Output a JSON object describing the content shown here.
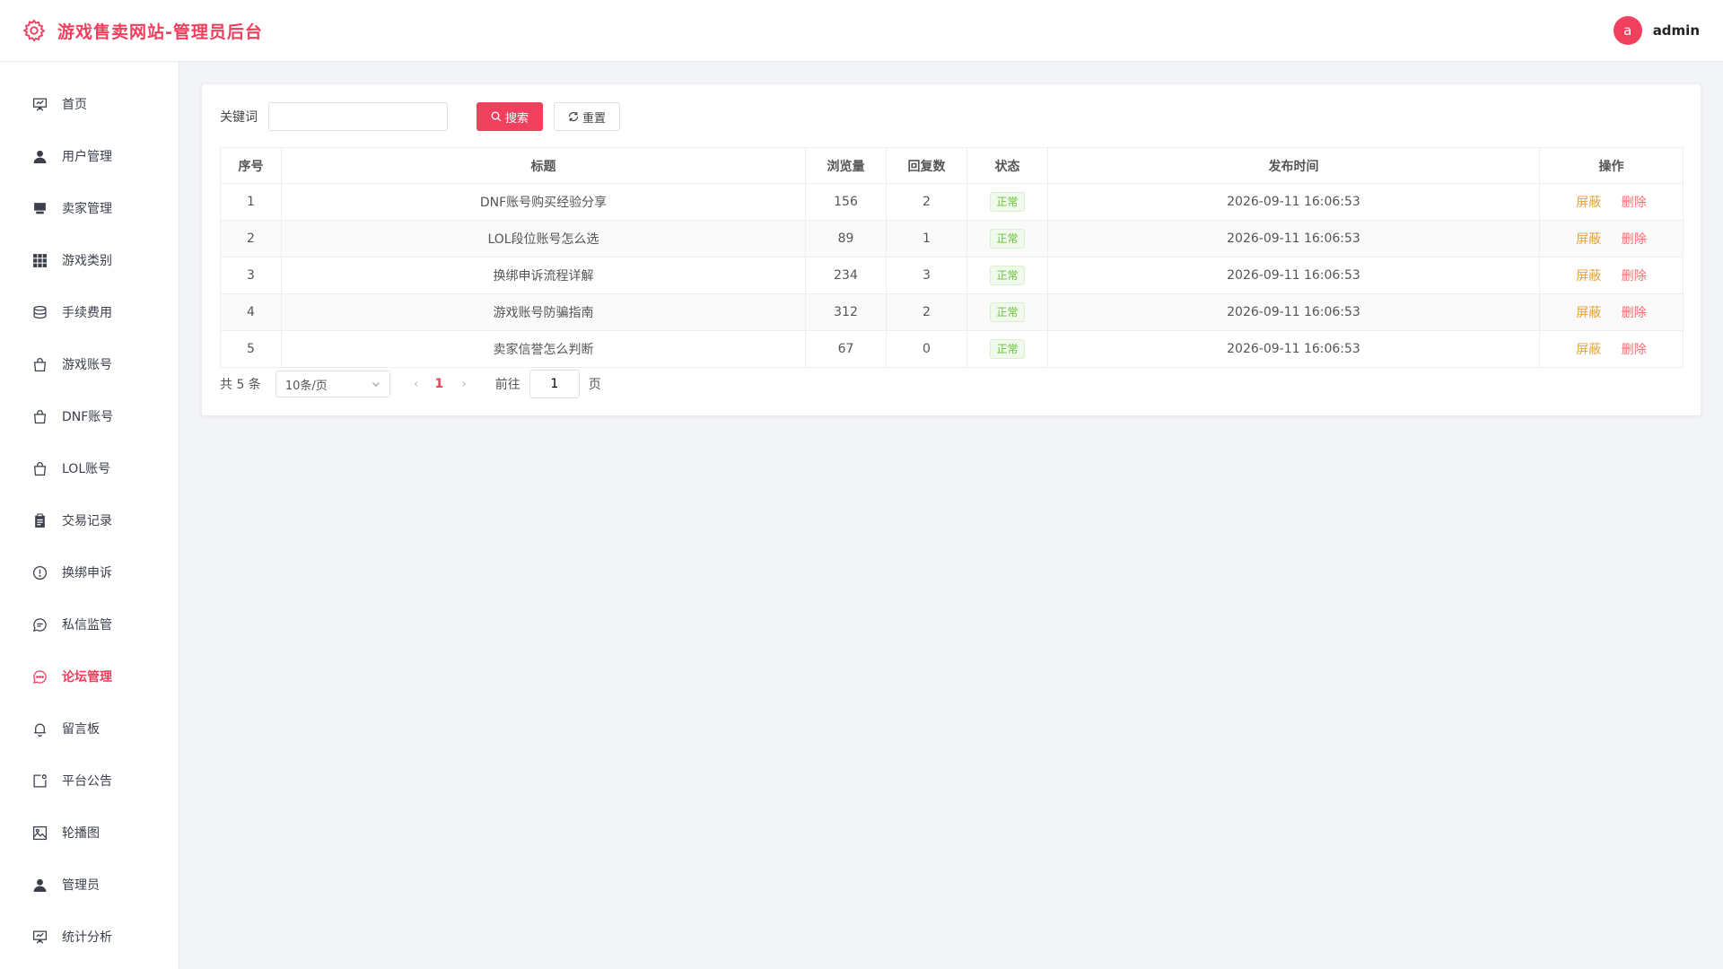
{
  "header": {
    "title": "游戏售卖网站-管理员后台",
    "avatar_letter": "a",
    "username": "admin",
    "accent": "#ee3f5d"
  },
  "sidebar": {
    "items": [
      {
        "label": "首页",
        "icon": "presentation-icon"
      },
      {
        "label": "用户管理",
        "icon": "user-icon"
      },
      {
        "label": "卖家管理",
        "icon": "store-icon"
      },
      {
        "label": "游戏类别",
        "icon": "grid-icon"
      },
      {
        "label": "手续费用",
        "icon": "coins-icon"
      },
      {
        "label": "游戏账号",
        "icon": "bag-icon"
      },
      {
        "label": "DNF账号",
        "icon": "bag-icon"
      },
      {
        "label": "LOL账号",
        "icon": "bag-icon"
      },
      {
        "label": "交易记录",
        "icon": "clipboard-icon"
      },
      {
        "label": "换绑申诉",
        "icon": "warning-icon"
      },
      {
        "label": "私信监管",
        "icon": "message-icon"
      },
      {
        "label": "论坛管理",
        "icon": "chat-dots-icon",
        "active": true
      },
      {
        "label": "留言板",
        "icon": "bell-icon"
      },
      {
        "label": "平台公告",
        "icon": "notice-icon"
      },
      {
        "label": "轮播图",
        "icon": "picture-icon"
      },
      {
        "label": "管理员",
        "icon": "admin-icon"
      },
      {
        "label": "统计分析",
        "icon": "chart-icon"
      }
    ]
  },
  "filter": {
    "keyword_label": "关键词",
    "keyword_value": "",
    "keyword_placeholder": "",
    "search_label": "搜索",
    "reset_label": "重置"
  },
  "table": {
    "columns": [
      "序号",
      "标题",
      "浏览量",
      "回复数",
      "状态",
      "发布时间",
      "操作"
    ],
    "rows": [
      {
        "index": "1",
        "title": "DNF账号购买经验分享",
        "views": "156",
        "replies": "2",
        "status": "正常",
        "time": "2026-09-11 16:06:53"
      },
      {
        "index": "2",
        "title": "LOL段位账号怎么选",
        "views": "89",
        "replies": "1",
        "status": "正常",
        "time": "2026-09-11 16:06:53"
      },
      {
        "index": "3",
        "title": "换绑申诉流程详解",
        "views": "234",
        "replies": "3",
        "status": "正常",
        "time": "2026-09-11 16:06:53"
      },
      {
        "index": "4",
        "title": "游戏账号防骗指南",
        "views": "312",
        "replies": "2",
        "status": "正常",
        "time": "2026-09-11 16:06:53"
      },
      {
        "index": "5",
        "title": "卖家信誉怎么判断",
        "views": "67",
        "replies": "0",
        "status": "正常",
        "time": "2026-09-11 16:06:53"
      }
    ],
    "op_block": "屏蔽",
    "op_delete": "删除"
  },
  "pager": {
    "total": "共 5 条",
    "page_size": "10条/页",
    "current": "1",
    "goto_label": "前往",
    "goto_value": "1",
    "page_suffix": "页"
  }
}
